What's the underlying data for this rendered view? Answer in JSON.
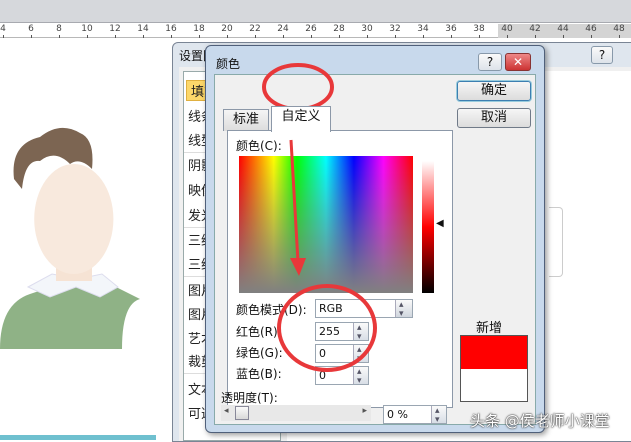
{
  "ruler": {
    "numbers": [
      "4",
      "6",
      "8",
      "10",
      "12",
      "14",
      "16",
      "18",
      "20",
      "22",
      "24",
      "26",
      "28",
      "30",
      "32",
      "34",
      "36",
      "38",
      "40",
      "42",
      "44",
      "46",
      "48"
    ]
  },
  "bg_dialog": {
    "title": "设置图片格式",
    "help": "?",
    "items": [
      "填充",
      "线条",
      "线型",
      "阴影",
      "映像",
      "发光",
      "三维格式",
      "三维旋转",
      "图片更正",
      "图片颜色",
      "艺术效果",
      "裁剪",
      "文本框",
      "可选文字"
    ]
  },
  "color_dialog": {
    "title": "颜色",
    "help": "?",
    "close": "✕",
    "tabs": [
      {
        "label": "标准"
      },
      {
        "label": "自定义",
        "active": true
      }
    ],
    "colors_label": "颜色(C):",
    "mode_label": "颜色模式(D):",
    "mode_value": "RGB",
    "red_label": "红色(R):",
    "red_value": "255",
    "green_label": "绿色(G):",
    "green_value": "0",
    "blue_label": "蓝色(B):",
    "blue_value": "0",
    "transparency_label": "透明度(T):",
    "transparency_value": "0 %",
    "transparency_fraction": 0,
    "ok": "确定",
    "cancel": "取消",
    "new_label": "新增",
    "new_color": "#ff0000",
    "current_color": "#ffffff"
  },
  "watermark": "头条 @侯老师小课堂"
}
